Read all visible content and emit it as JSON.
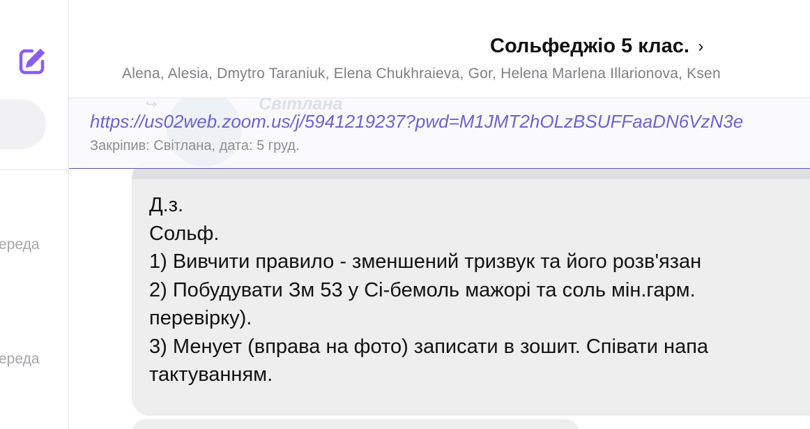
{
  "sidebar": {
    "compose_icon": "compose-icon",
    "previews": [
      "ереда",
      "ереда"
    ]
  },
  "header": {
    "title": "Сольфеджіо 5 клас.",
    "chevron": "›",
    "members": "Alena, Alesia, Dmytro Taraniuk, Elena  Chukhraieva, Gor, Helena Marlena Illarionova, Ksen"
  },
  "pinned": {
    "ghost_name": "Світлана",
    "link": "https://us02web.zoom.us/j/5941219237?pwd=M1JMT2hOLzBSUFFaaDN6VzN3e",
    "meta": "Закріпив: Світлана, дата: 5 груд."
  },
  "message": {
    "lines": [
      "Д.з.",
      "Сольф.",
      "1) Вивчити правило - зменшений тризвук та його розв'язан",
      "2) Побудувати Зм 53 у Сі-бемоль мажорі та соль мін.гарм.",
      "перевірку).",
      "3) Менует (вправа на фото) записати в зошит. Співати напа",
      "тактуванням."
    ]
  },
  "colors": {
    "accent": "#8b5cf6",
    "link": "#6b63cf",
    "bubble": "#eeeeef"
  }
}
